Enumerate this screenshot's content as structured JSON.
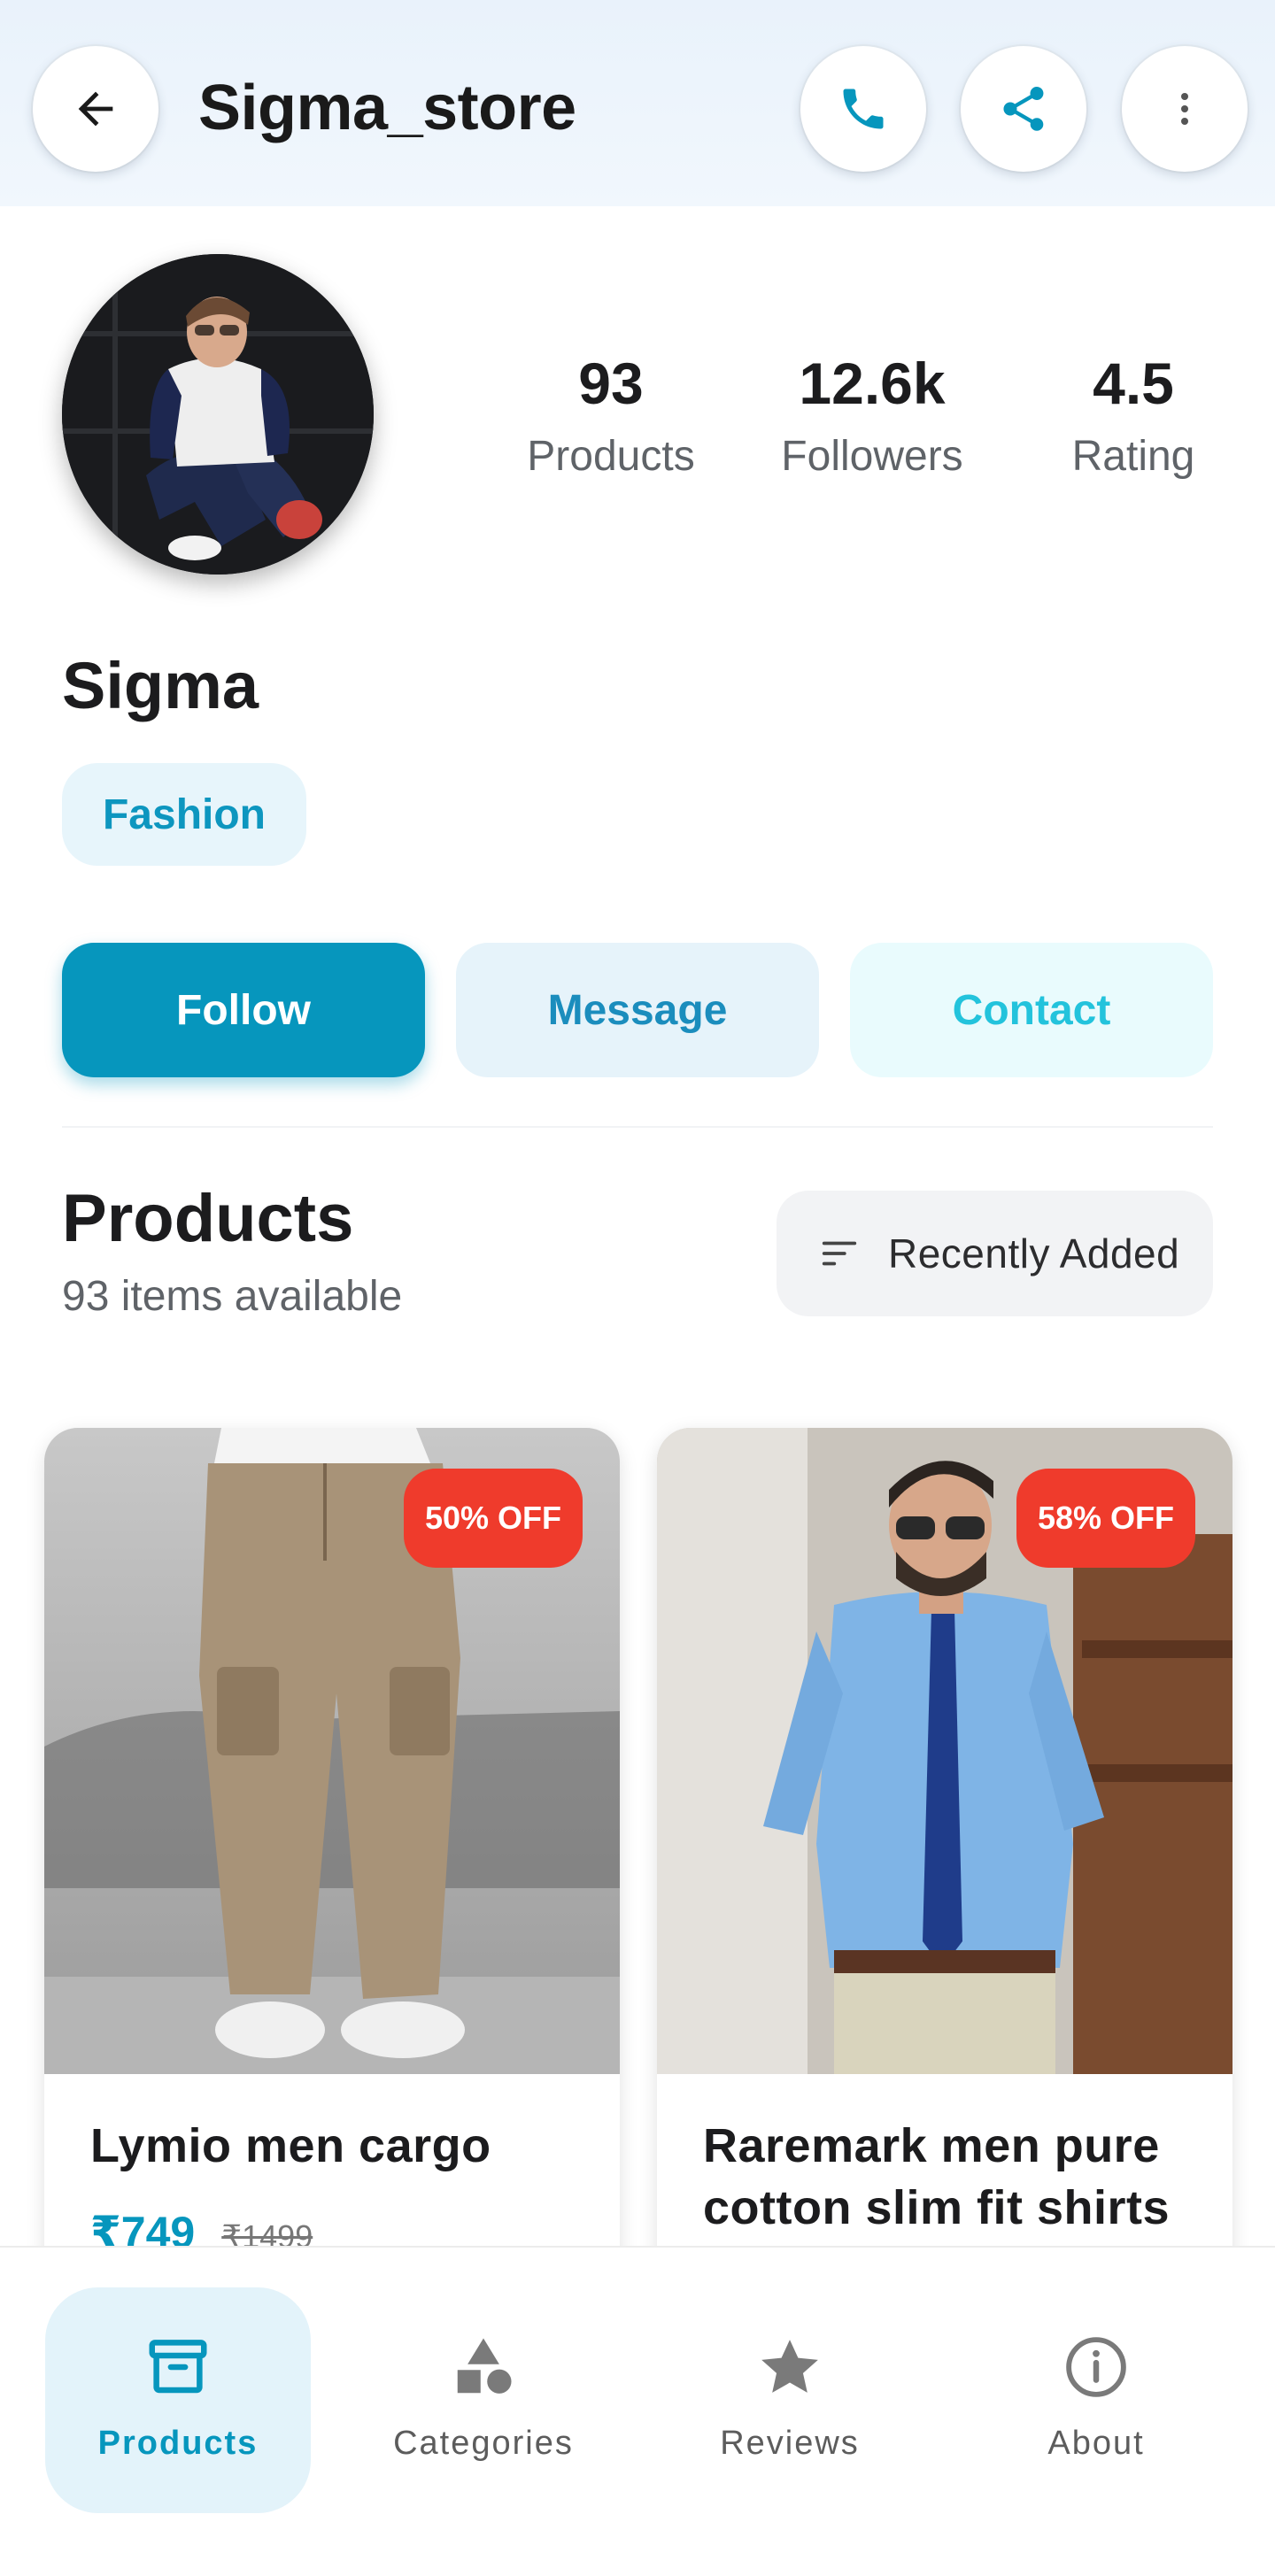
{
  "appbar": {
    "title": "Sigma_store",
    "icons": [
      "back-arrow-icon",
      "phone-icon",
      "share-icon",
      "more-vert-icon"
    ]
  },
  "profile": {
    "name": "Sigma",
    "category": "Fashion",
    "stats": [
      {
        "value": "93",
        "label": "Products"
      },
      {
        "value": "12.6k",
        "label": "Followers"
      },
      {
        "value": "4.5",
        "label": "Rating"
      }
    ]
  },
  "actions": {
    "follow": "Follow",
    "message": "Message",
    "contact": "Contact"
  },
  "products_section": {
    "title": "Products",
    "subtitle": "93 items available",
    "sort_label": "Recently Added"
  },
  "products": [
    {
      "name": "Lymio men cargo",
      "discount": "50% OFF",
      "price": "₹749",
      "old_price": "₹1499"
    },
    {
      "name": "Raremark men pure cotton slim fit shirts",
      "discount": "58% OFF"
    }
  ],
  "bottom_nav": [
    {
      "label": "Products",
      "icon": "archive-box-icon",
      "active": true
    },
    {
      "label": "Categories",
      "icon": "shapes-icon",
      "active": false
    },
    {
      "label": "Reviews",
      "icon": "star-icon",
      "active": false
    },
    {
      "label": "About",
      "icon": "info-icon",
      "active": false
    }
  ],
  "colors": {
    "accent": "#0696bd",
    "badge": "#ef3b2c",
    "appbar_bg": "#e9f2fb"
  }
}
